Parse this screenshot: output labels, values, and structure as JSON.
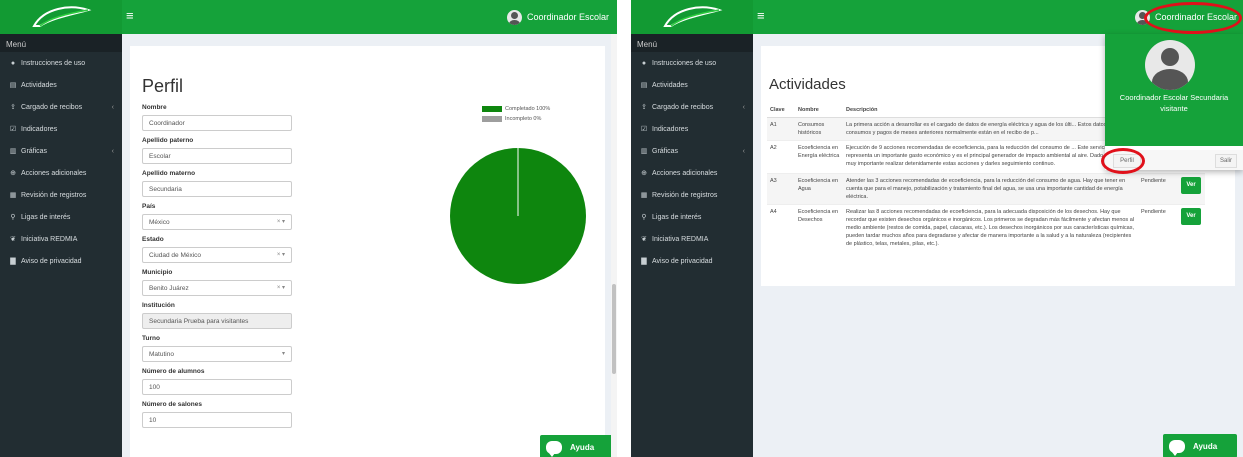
{
  "colors": {
    "brand": "#15a23a",
    "sidebar": "#222d32",
    "highlight": "#e0101a",
    "pie_completed": "#0e860e",
    "pie_incomplete": "#9e9e9e"
  },
  "header": {
    "menu_icon": "hamburger-icon",
    "user_name": "Coordinador Escolar"
  },
  "sidebar": {
    "title": "Menú",
    "items": [
      {
        "label": "Instrucciones de uso",
        "icon": "info-icon"
      },
      {
        "label": "Actividades",
        "icon": "list-icon"
      },
      {
        "label": "Cargado de recibos",
        "icon": "upload-icon",
        "has_children": true
      },
      {
        "label": "Indicadores",
        "icon": "check-square-icon"
      },
      {
        "label": "Gráficas",
        "icon": "chart-icon",
        "has_children": true
      },
      {
        "label": "Acciones adicionales",
        "icon": "plus-circle-icon"
      },
      {
        "label": "Revisión de registros",
        "icon": "table-icon"
      },
      {
        "label": "Ligas de interés",
        "icon": "link-icon"
      },
      {
        "label": "Iniciativa REDMIA",
        "icon": "leaf-icon"
      },
      {
        "label": "Aviso de privacidad",
        "icon": "document-icon"
      }
    ]
  },
  "profile": {
    "title": "Perfil",
    "fields": [
      {
        "label": "Nombre",
        "value": "Coordinador",
        "type": "text"
      },
      {
        "label": "Apellido paterno",
        "value": "Escolar",
        "type": "text"
      },
      {
        "label": "Apellido materno",
        "value": "Secundaria",
        "type": "text"
      },
      {
        "label": "País",
        "value": "México",
        "type": "select-clear"
      },
      {
        "label": "Estado",
        "value": "Ciudad de México",
        "type": "select-clear"
      },
      {
        "label": "Municipio",
        "value": "Benito Juárez",
        "type": "select-clear"
      },
      {
        "label": "Institución",
        "value": "Secundaria Prueba para visitantes",
        "type": "disabled"
      },
      {
        "label": "Turno",
        "value": "Matutino",
        "type": "select"
      },
      {
        "label": "Número de alumnos",
        "value": "100",
        "type": "text"
      },
      {
        "label": "Número de salones",
        "value": "10",
        "type": "text"
      }
    ],
    "select_indicator": "× ▾",
    "select_indicator_plain": "▾",
    "legend": [
      {
        "label": "Completado 100%",
        "color": "#0e860e"
      },
      {
        "label": "Incompleto 0%",
        "color": "#9e9e9e"
      }
    ]
  },
  "chart_data": {
    "type": "pie",
    "categories": [
      "Completado",
      "Incompleto"
    ],
    "values": [
      100,
      0
    ],
    "legend_position": "top-right"
  },
  "help": {
    "label": "Ayuda"
  },
  "activities": {
    "title": "Actividades",
    "columns": [
      "Clave",
      "Nombre",
      "Descripción"
    ],
    "rows": [
      {
        "key": "A1",
        "name": "Consumos históricos",
        "description": "La primera acción a desarrollar es el cargado de datos de energía eléctrica y agua de los últi... Estos datos de consumos y pagos de meses anteriores normalmente están en el recibo de p...",
        "status": "",
        "action": ""
      },
      {
        "key": "A2",
        "name": "Ecoeficiencia en Energía eléctrica",
        "description": "Ejecución de 9 acciones recomendadas de ecoeficiencia, para la reducción del consumo de ... Este servicio representa un importante gasto económico y es el principal generador de impacto ambiental al aire. Dado esto, es muy importante realizar detenidamente estas acciones y darles seguimiento continuo.",
        "status": "",
        "action": ""
      },
      {
        "key": "A3",
        "name": "Ecoeficiencia en Agua",
        "description": "Atender las 3 acciones recomendadas de ecoeficiencia, para la reducción del consumo de agua. Hay que tener en cuenta que para el manejo, potabilización y tratamiento final del agua, se usa una importante cantidad de energía eléctrica.",
        "status": "Pendiente",
        "action": "Ver"
      },
      {
        "key": "A4",
        "name": "Ecoeficiencia en Desechos",
        "description": "Realizar las 8 acciones recomendadas de ecoeficiencia, para la adecuada disposición de los desechos. Hay que recordar que existen desechos orgánicos e inorgánicos. Los primeros se degradan más fácilmente y afectan menos al medio ambiente (restos de comida, papel, cáscaras, etc.). Los desechos inorgánicos por sus características químicas, pueden tardar muchos años para degradarse y afectar de manera importante a la salud y a la naturaleza (recipientes de plástico, telas, metales, pilas, etc.).",
        "status": "Pendiente",
        "action": "Ver"
      }
    ]
  },
  "user_dropdown": {
    "name": "Coordinador Escolar Secundaria visitante",
    "profile_button": "Perfil",
    "logout_button": "Salir"
  }
}
